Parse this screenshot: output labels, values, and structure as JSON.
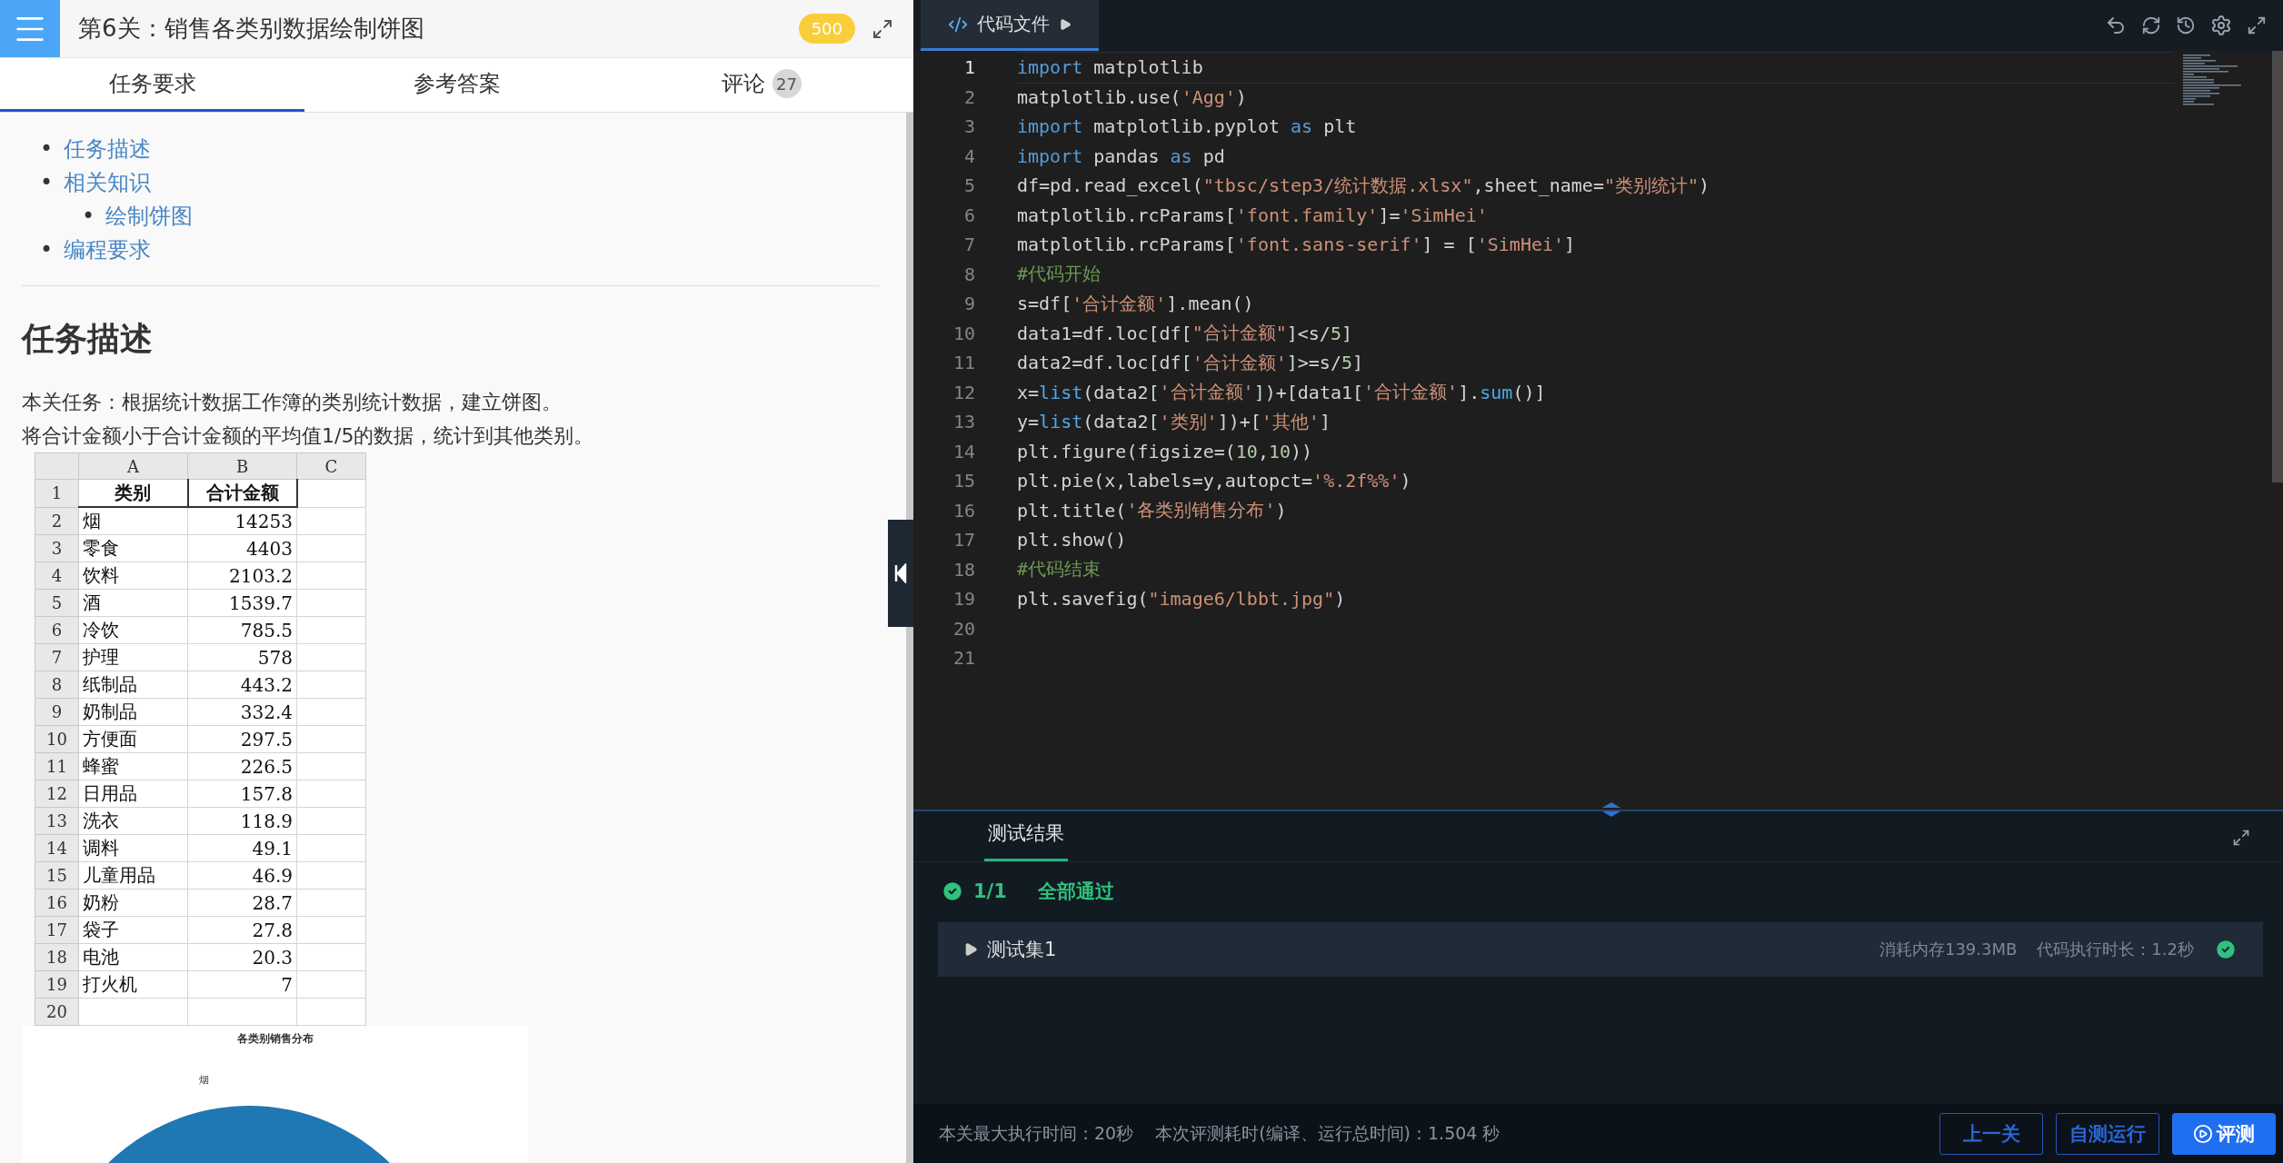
{
  "header": {
    "title": "第6关：销售各类别数据绘制饼图",
    "score": "500"
  },
  "tabs": [
    {
      "label": "任务要求",
      "selected": true
    },
    {
      "label": "参考答案",
      "selected": false
    },
    {
      "label": "评论",
      "count": "27",
      "selected": false
    }
  ],
  "toc": [
    {
      "marker": "•",
      "label": "任务描述"
    },
    {
      "marker": "•",
      "label": "相关知识",
      "children": [
        {
          "marker": "•",
          "label": "绘制饼图"
        }
      ]
    },
    {
      "marker": "•",
      "label": "编程要求"
    }
  ],
  "section": {
    "heading": "任务描述",
    "paragraphs": [
      "本关任务：根据统计数据工作簿的类别统计数据，建立饼图。",
      "将合计金额小于合计金额的平均值1/5的数据，统计到其他类别。"
    ]
  },
  "spreadsheet": {
    "columns": [
      "A",
      "B",
      "C"
    ],
    "rows": [
      {
        "number": "1",
        "header": true,
        "cells": [
          "类别",
          "合计金额"
        ]
      },
      {
        "number": "2",
        "header": false,
        "cells": [
          "烟",
          "14253"
        ]
      },
      {
        "number": "3",
        "header": false,
        "cells": [
          "零食",
          "4403"
        ]
      },
      {
        "number": "4",
        "header": false,
        "cells": [
          "饮料",
          "2103.2"
        ]
      },
      {
        "number": "5",
        "header": false,
        "cells": [
          "酒",
          "1539.7"
        ]
      },
      {
        "number": "6",
        "header": false,
        "cells": [
          "冷饮",
          "785.5"
        ]
      },
      {
        "number": "7",
        "header": false,
        "cells": [
          "护理",
          "578"
        ]
      },
      {
        "number": "8",
        "header": false,
        "cells": [
          "纸制品",
          "443.2"
        ]
      },
      {
        "number": "9",
        "header": false,
        "cells": [
          "奶制品",
          "332.4"
        ]
      },
      {
        "number": "10",
        "header": false,
        "cells": [
          "方便面",
          "297.5"
        ]
      },
      {
        "number": "11",
        "header": false,
        "cells": [
          "蜂蜜",
          "226.5"
        ]
      },
      {
        "number": "12",
        "header": false,
        "cells": [
          "日用品",
          "157.8"
        ]
      },
      {
        "number": "13",
        "header": false,
        "cells": [
          "洗衣",
          "118.9"
        ]
      },
      {
        "number": "14",
        "header": false,
        "cells": [
          "调料",
          "49.1"
        ]
      },
      {
        "number": "15",
        "header": false,
        "cells": [
          "儿童用品",
          "46.9"
        ]
      },
      {
        "number": "16",
        "header": false,
        "cells": [
          "奶粉",
          "28.7"
        ]
      },
      {
        "number": "17",
        "header": false,
        "cells": [
          "袋子",
          "27.8"
        ]
      },
      {
        "number": "18",
        "header": false,
        "cells": [
          "电池",
          "20.3"
        ]
      },
      {
        "number": "19",
        "header": false,
        "cells": [
          "打火机",
          "7"
        ]
      },
      {
        "number": "20",
        "header": false
      }
    ]
  },
  "pie_image": {
    "title": "各类别销售分布",
    "label": "烟"
  },
  "editor": {
    "tab": "代码文件",
    "lines": [
      {
        "number": "1",
        "active": true,
        "tokens": [
          {
            "kind": "keyword",
            "text": "import"
          },
          {
            "kind": "plain",
            "text": " matplotlib"
          }
        ]
      },
      {
        "number": "2",
        "active": false,
        "tokens": [
          {
            "kind": "plain",
            "text": "matplotlib.use("
          },
          {
            "kind": "string",
            "text": "'Agg'"
          },
          {
            "kind": "plain",
            "text": ")"
          }
        ]
      },
      {
        "number": "3",
        "active": false,
        "tokens": [
          {
            "kind": "keyword",
            "text": "import"
          },
          {
            "kind": "plain",
            "text": " matplotlib.pyplot "
          },
          {
            "kind": "keyword",
            "text": "as"
          },
          {
            "kind": "plain",
            "text": " plt"
          }
        ]
      },
      {
        "number": "4",
        "active": false,
        "tokens": [
          {
            "kind": "keyword",
            "text": "import"
          },
          {
            "kind": "plain",
            "text": " pandas "
          },
          {
            "kind": "keyword",
            "text": "as"
          },
          {
            "kind": "plain",
            "text": " pd"
          }
        ]
      },
      {
        "number": "5",
        "active": false,
        "tokens": [
          {
            "kind": "plain",
            "text": "df=pd.read_excel("
          },
          {
            "kind": "string",
            "text": "\"tbsc/step3/统计数据.xlsx\""
          },
          {
            "kind": "plain",
            "text": ",sheet_name="
          },
          {
            "kind": "string",
            "text": "\"类别统计\""
          },
          {
            "kind": "plain",
            "text": ")"
          }
        ]
      },
      {
        "number": "6",
        "active": false,
        "tokens": [
          {
            "kind": "plain",
            "text": "matplotlib.rcParams["
          },
          {
            "kind": "string",
            "text": "'font.family'"
          },
          {
            "kind": "plain",
            "text": "]="
          },
          {
            "kind": "string",
            "text": "'SimHei'"
          }
        ]
      },
      {
        "number": "7",
        "active": false,
        "tokens": [
          {
            "kind": "plain",
            "text": "matplotlib.rcParams["
          },
          {
            "kind": "string",
            "text": "'font.sans-serif'"
          },
          {
            "kind": "plain",
            "text": "] = ["
          },
          {
            "kind": "string",
            "text": "'SimHei'"
          },
          {
            "kind": "plain",
            "text": "]"
          }
        ]
      },
      {
        "number": "8",
        "active": false,
        "tokens": [
          {
            "kind": "comment",
            "text": "#代码开始"
          }
        ]
      },
      {
        "number": "9",
        "active": false,
        "tokens": [
          {
            "kind": "plain",
            "text": "s=df["
          },
          {
            "kind": "string",
            "text": "'合计金额'"
          },
          {
            "kind": "plain",
            "text": "].mean()"
          }
        ]
      },
      {
        "number": "10",
        "active": false,
        "tokens": [
          {
            "kind": "plain",
            "text": "data1=df.loc[df["
          },
          {
            "kind": "string",
            "text": "\"合计金额\""
          },
          {
            "kind": "plain",
            "text": "]<s/"
          },
          {
            "kind": "number",
            "text": "5"
          },
          {
            "kind": "plain",
            "text": "]"
          }
        ]
      },
      {
        "number": "11",
        "active": false,
        "tokens": [
          {
            "kind": "plain",
            "text": "data2=df.loc[df["
          },
          {
            "kind": "string",
            "text": "'合计金额'"
          },
          {
            "kind": "plain",
            "text": "]>=s/"
          },
          {
            "kind": "number",
            "text": "5"
          },
          {
            "kind": "plain",
            "text": "]"
          }
        ]
      },
      {
        "number": "12",
        "active": false,
        "tokens": [
          {
            "kind": "plain",
            "text": "x="
          },
          {
            "kind": "builtin",
            "text": "list"
          },
          {
            "kind": "plain",
            "text": "(data2["
          },
          {
            "kind": "string",
            "text": "'合计金额'"
          },
          {
            "kind": "plain",
            "text": "])+[data1["
          },
          {
            "kind": "string",
            "text": "'合计金额'"
          },
          {
            "kind": "plain",
            "text": "]."
          },
          {
            "kind": "builtin",
            "text": "sum"
          },
          {
            "kind": "plain",
            "text": "()]"
          }
        ]
      },
      {
        "number": "13",
        "active": false,
        "tokens": [
          {
            "kind": "plain",
            "text": "y="
          },
          {
            "kind": "builtin",
            "text": "list"
          },
          {
            "kind": "plain",
            "text": "(data2["
          },
          {
            "kind": "string",
            "text": "'类别'"
          },
          {
            "kind": "plain",
            "text": "])+["
          },
          {
            "kind": "string",
            "text": "'其他'"
          },
          {
            "kind": "plain",
            "text": "]"
          }
        ]
      },
      {
        "number": "14",
        "active": false,
        "tokens": [
          {
            "kind": "plain",
            "text": "plt.figure(figsize=("
          },
          {
            "kind": "number",
            "text": "10"
          },
          {
            "kind": "plain",
            "text": ","
          },
          {
            "kind": "number",
            "text": "10"
          },
          {
            "kind": "plain",
            "text": "))"
          }
        ]
      },
      {
        "number": "15",
        "active": false,
        "tokens": [
          {
            "kind": "plain",
            "text": "plt.pie(x,labels=y,autopct="
          },
          {
            "kind": "string",
            "text": "'%.2f%%'"
          },
          {
            "kind": "plain",
            "text": ")"
          }
        ]
      },
      {
        "number": "16",
        "active": false,
        "tokens": [
          {
            "kind": "plain",
            "text": "plt.title("
          },
          {
            "kind": "string",
            "text": "'各类别销售分布'"
          },
          {
            "kind": "plain",
            "text": ")"
          }
        ]
      },
      {
        "number": "17",
        "active": false,
        "tokens": [
          {
            "kind": "plain",
            "text": "plt.show()"
          }
        ]
      },
      {
        "number": "18",
        "active": false,
        "tokens": [
          {
            "kind": "comment",
            "text": "#代码结束"
          }
        ]
      },
      {
        "number": "19",
        "active": false,
        "tokens": [
          {
            "kind": "plain",
            "text": "plt.savefig("
          },
          {
            "kind": "string",
            "text": "\"image6/lbbt.jpg\""
          },
          {
            "kind": "plain",
            "text": ")"
          }
        ]
      },
      {
        "number": "20",
        "active": false
      },
      {
        "number": "21",
        "active": false
      }
    ]
  },
  "results": {
    "tab": "测试结果",
    "score": "1/1",
    "status": "全部通过",
    "sets": [
      {
        "name": "测试集1",
        "memory": "消耗内存139.3MB",
        "duration": "代码执行时长：1.2秒",
        "passed": true
      }
    ]
  },
  "footer": {
    "limit": "本关最大执行时间：20秒",
    "elapsed": "本次评测耗时(编译、运行总时间)：1.504 秒",
    "buttons": [
      {
        "label": "上一关",
        "kind": "outline"
      },
      {
        "label": "自测运行",
        "kind": "outline"
      },
      {
        "label": "评测",
        "kind": "primary"
      }
    ]
  }
}
